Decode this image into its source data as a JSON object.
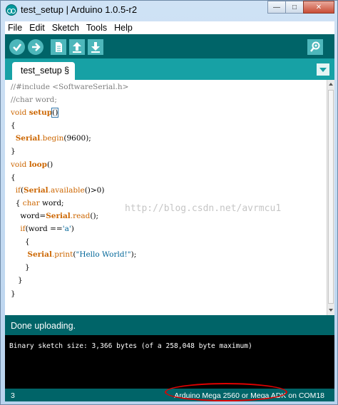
{
  "window": {
    "title": "test_setup | Arduino 1.0.5-r2"
  },
  "menu": [
    "File",
    "Edit",
    "Sketch",
    "Tools",
    "Help"
  ],
  "toolbar": {
    "verify": "verify-icon",
    "upload": "upload-icon",
    "new": "new-icon",
    "open": "open-icon",
    "save": "save-icon",
    "serial_monitor": "serial-monitor-icon"
  },
  "tab": {
    "label": "test_setup §"
  },
  "code": {
    "l1": "//#include <SoftwareSerial.h>",
    "l2": "//char word;",
    "l3a": "void",
    "l3b": "setup",
    "l3c": "()",
    "l4": "{",
    "l5a": "Serial",
    "l5b": ".begin",
    "l5c": "(9600);",
    "l6": "}",
    "l7a": "void",
    "l7b": "loop",
    "l7c": "()",
    "l8": "{",
    "l9a": "if",
    "l9b": "(",
    "l9c": "Serial",
    "l9d": ".available",
    "l9e": "()>0)",
    "l10a": "{ ",
    "l10b": "char",
    "l10c": " word;",
    "l11a": "word=",
    "l11b": "Serial",
    "l11c": ".read",
    "l11d": "();",
    "l12a": "if",
    "l12b": "(word ==",
    "l12c": "'a'",
    "l12d": ")",
    "l13": "{",
    "l14a": "Serial",
    "l14b": ".print",
    "l14c": "(",
    "l14d": "\"Hello World!\"",
    "l14e": ");",
    "l15": "}",
    "l16": "}",
    "l17": "}"
  },
  "watermark": "http://blog.csdn.net/avrmcu1",
  "status": {
    "message": "Done uploading."
  },
  "console": {
    "text": "Binary sketch size: 3,366 bytes (of a 258,048 byte maximum)"
  },
  "footer": {
    "line": "3",
    "board": "Arduino Mega 2560 or Mega ADK on COM18"
  },
  "colors": {
    "teal_dark": "#006468",
    "teal_tab": "#17a1a5",
    "button": "#4db7bb",
    "keyword": "#cc6600",
    "annotation_red": "#e10000"
  }
}
